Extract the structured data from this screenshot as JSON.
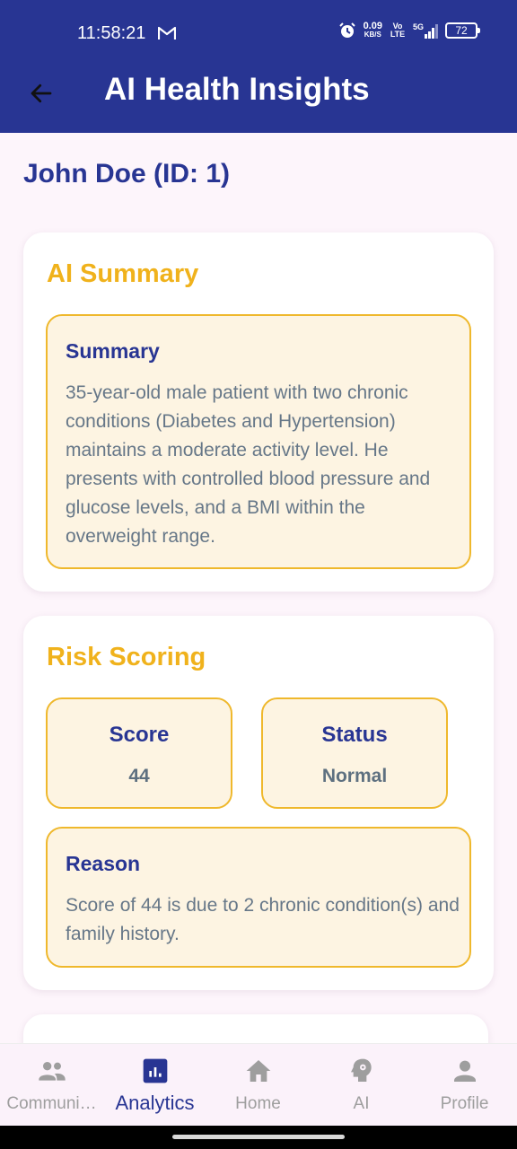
{
  "status_bar": {
    "time": "11:58:21",
    "net_speed_value": "0.09",
    "net_speed_unit": "KB/S",
    "volte": "Vo LTE",
    "network": "5G",
    "battery": "72"
  },
  "header": {
    "title": "AI Health Insights"
  },
  "patient": {
    "name": "John Doe (ID: 1)"
  },
  "ai_summary": {
    "title": "AI Summary",
    "summary_label": "Summary",
    "summary_text": "35-year-old male patient with two chronic conditions (Diabetes and Hypertension) maintains a moderate activity level.  He presents with controlled blood pressure and glucose levels, and a BMI within the overweight range."
  },
  "risk_scoring": {
    "title": "Risk Scoring",
    "score_label": "Score",
    "score_value": "44",
    "status_label": "Status",
    "status_value": "Normal",
    "reason_label": "Reason",
    "reason_text": "Score of 44 is due to 2 chronic condition(s) and family history."
  },
  "bottom_nav": {
    "items": [
      {
        "label": "Communi…",
        "icon": "people-icon",
        "active": false
      },
      {
        "label": "Analytics",
        "icon": "analytics-icon",
        "active": true
      },
      {
        "label": "Home",
        "icon": "home-icon",
        "active": false
      },
      {
        "label": "AI",
        "icon": "ai-brain-icon",
        "active": false
      },
      {
        "label": "Profile",
        "icon": "person-icon",
        "active": false
      }
    ]
  },
  "colors": {
    "primary": "#283593",
    "accent": "#F0B21C",
    "box_background": "#FDF4E2",
    "box_border": "#EFB82C",
    "muted_text": "#667788",
    "page_background": "#FDF5FB"
  }
}
